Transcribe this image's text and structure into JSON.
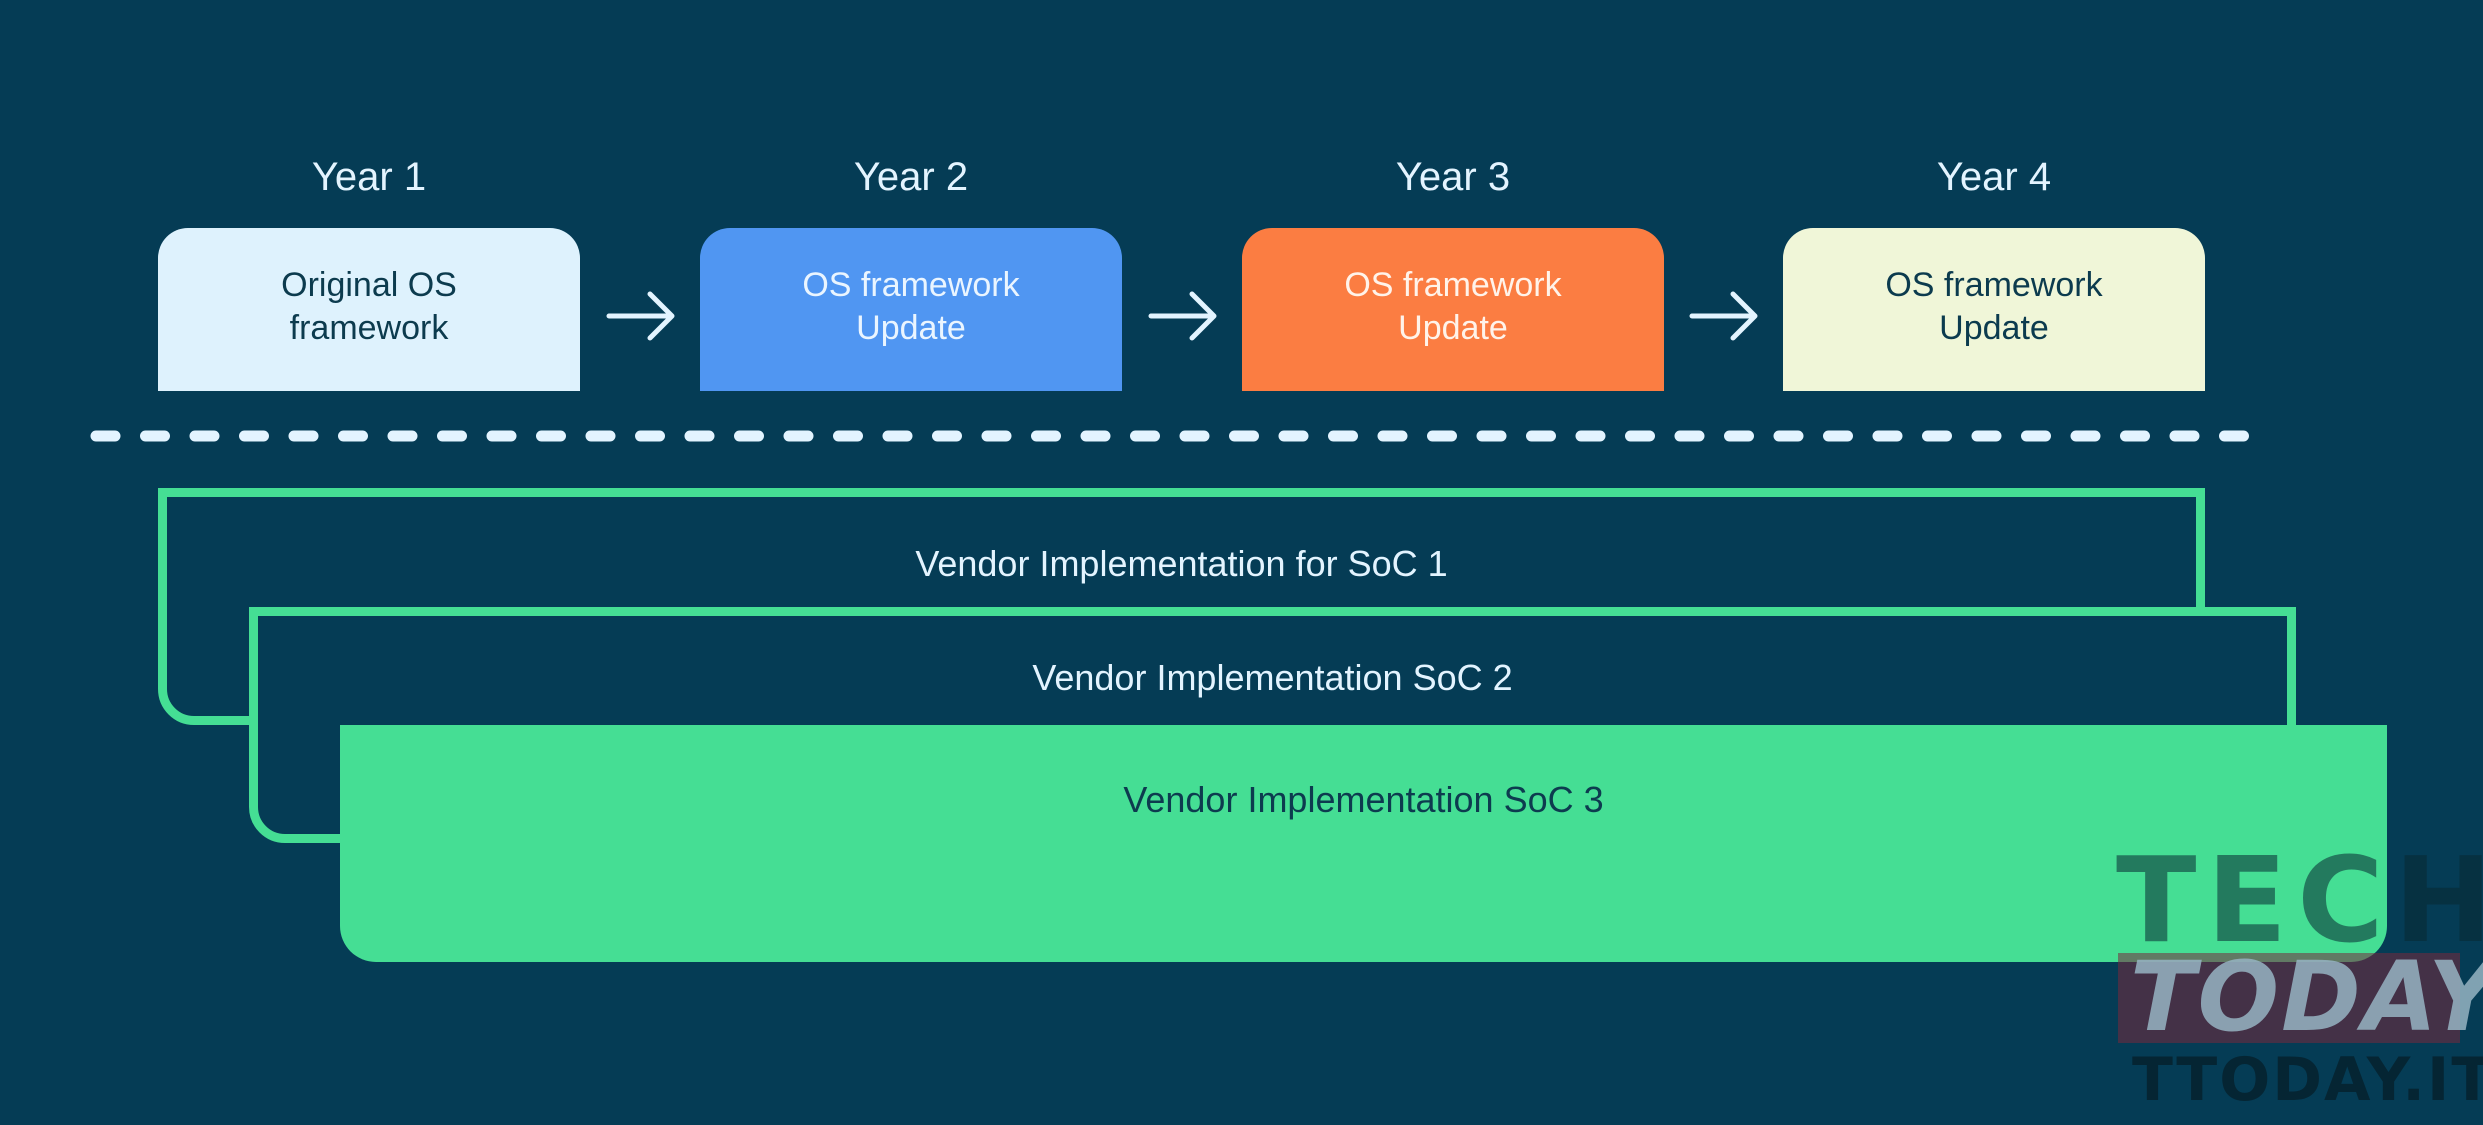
{
  "timeline": {
    "years": [
      {
        "label": "Year 1",
        "box_text": "Original OS\nframework",
        "color": "#def2fd"
      },
      {
        "label": "Year 2",
        "box_text": "OS framework\nUpdate",
        "color": "#5096f2"
      },
      {
        "label": "Year 3",
        "box_text": "OS framework\nUpdate",
        "color": "#fb7d42"
      },
      {
        "label": "Year 4",
        "box_text": "OS framework\nUpdate",
        "color": "#f0f6d8"
      }
    ],
    "arrow_icon": "right-arrow-icon"
  },
  "vendor_layers": [
    {
      "label": "Vendor Implementation for SoC 1",
      "style": "outline"
    },
    {
      "label": "Vendor Implementation SoC 2",
      "style": "outline"
    },
    {
      "label": "Vendor Implementation SoC 3",
      "style": "filled"
    }
  ],
  "colors": {
    "background": "#053c55",
    "accent_green": "#45de94",
    "divider": "#e3f4ff"
  },
  "watermark": {
    "line1": "TECH",
    "line2": "TODAY",
    "line3": "TTODAY.IT"
  }
}
